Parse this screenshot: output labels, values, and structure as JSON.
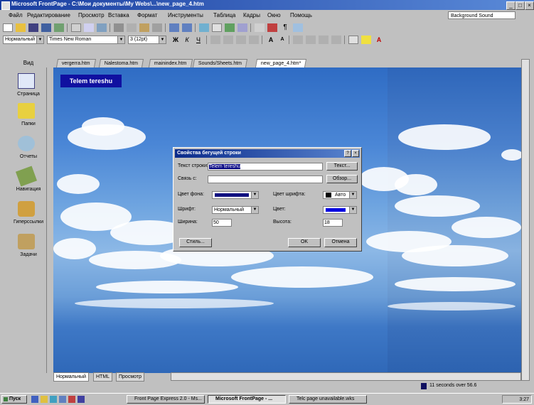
{
  "window": {
    "title": "Microsoft FrontPage - C:\\Мои документы\\My Webs\\...\\new_page_4.htm"
  },
  "menu": {
    "items": [
      "Файл",
      "Редактирование",
      "Просмотр",
      "Вставка",
      "Формат",
      "Инструменты",
      "Таблица",
      "Кадры",
      "Окно",
      "Помощь"
    ],
    "help_box": "Background Sound"
  },
  "toolbar": {
    "style_select": "Нормальный",
    "font_select": "Times New Roman",
    "size_select": "3 (12pt)",
    "bold": "Ж",
    "italic": "К",
    "underline": "Ч",
    "font_color": "A"
  },
  "views": {
    "header": "Вид",
    "items": [
      "Страница",
      "Папки",
      "Отчеты",
      "Навигация",
      "Гиперссылки",
      "Задачи"
    ]
  },
  "tabs": [
    "vergerra.htm",
    "Nalestoma.htm",
    "mainindex.htm",
    "Sounds/Sheets.htm",
    "new_page_4.htm*"
  ],
  "page": {
    "title_box": "Telem tereshu"
  },
  "dialog": {
    "title": "Свойства бегущей строки",
    "fields": {
      "text_label": "Текст строки:",
      "text_value": "Telem tereshu",
      "link_label": "Связь с:",
      "link_value": "",
      "bgcolor_label": "Цвет фона:",
      "font_label": "Шрифт:",
      "font_value": "Нормальный",
      "width_label": "Ширина:",
      "width_value": "50",
      "color_label": "Цвет шрифта:",
      "color_value": "Авто",
      "color2_label": "Цвет:",
      "height_label": "Высота:",
      "height_value": "18"
    },
    "buttons": {
      "style": "Стиль...",
      "ok": "OK",
      "cancel": "Отмена",
      "browse": "Обзор...",
      "help": "Текст..."
    }
  },
  "bottom_tabs": [
    "Нормальный",
    "HTML",
    "Просмотр"
  ],
  "status": "11 seconds over 56.6",
  "taskbar": {
    "start": "Пуск",
    "tasks": [
      "Front Page Express 2.0 - Ms...",
      "Microsoft FrontPage - ...",
      "Telc page unavailable.wks"
    ],
    "time": "3:27"
  },
  "colors": {
    "dialog_blue": "#1010a0",
    "title_blue": "#1a3ea0"
  }
}
